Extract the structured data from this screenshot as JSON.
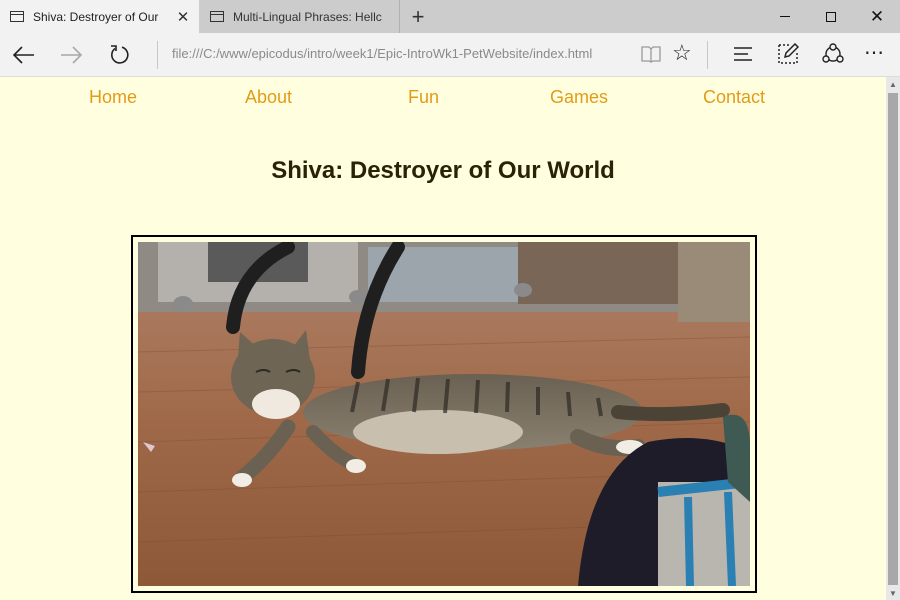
{
  "browser": {
    "tabs": [
      {
        "title": "Shiva: Destroyer of Our",
        "active": true
      },
      {
        "title": "Multi-Lingual Phrases: Hellc",
        "active": false
      }
    ],
    "address": "file:///C:/www/epicodus/intro/week1/Epic-IntroWk1-PetWebsite/index.html",
    "icons": {
      "back": "back-arrow-icon",
      "forward": "forward-arrow-icon",
      "refresh": "refresh-icon",
      "reading_view": "reading-view-icon",
      "favorite": "star-icon",
      "hub": "hub-icon",
      "web_note": "web-note-icon",
      "share": "share-icon",
      "more": "more-icon"
    }
  },
  "page": {
    "nav": [
      "Home",
      "About",
      "Fun",
      "Games",
      "Contact"
    ],
    "heading": "Shiva: Destroyer of Our World",
    "photo": {
      "subject": "tabby-cat-photo"
    }
  },
  "colors": {
    "page_background": "#ffffdf",
    "nav_link": "#e49a19",
    "heading": "#2a2208"
  }
}
